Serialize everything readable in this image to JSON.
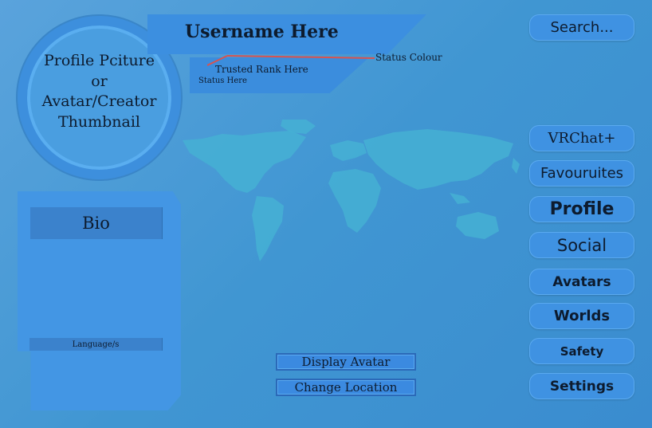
{
  "profile": {
    "username": "Username Here",
    "avatar_placeholder_lines": [
      "Profile Pciture",
      "or",
      "Avatar/Creator",
      "Thumbnail"
    ],
    "trusted_rank": "Trusted Rank Here",
    "status": "Status Here",
    "status_colour_label": "Status Colour"
  },
  "bio": {
    "title": "Bio",
    "languages_label": "Language/s"
  },
  "actions": {
    "display_avatar": "Display Avatar",
    "change_location": "Change Location"
  },
  "search": {
    "label": "Search..."
  },
  "menu": {
    "items": [
      "VRChat+",
      "Favouruites",
      "Profile",
      "Social",
      "Avatars",
      "Worlds",
      "Safety",
      "Settings"
    ]
  },
  "colors": {
    "background": "#4096d2",
    "panel": "#3c8fe0",
    "map": "#45b0d3",
    "status_line": "#d9534f",
    "text": "#0d1b2e"
  }
}
